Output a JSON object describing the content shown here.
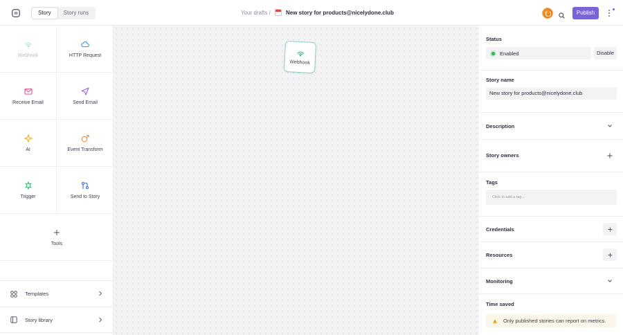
{
  "header": {
    "tabs": [
      {
        "label": "Story",
        "active": true
      },
      {
        "label": "Story runs",
        "active": false
      }
    ],
    "breadcrumb": "Your drafts /",
    "story_title": "New story for products@nicelydone.club",
    "publish_label": "Publish"
  },
  "left_panel": {
    "actions": [
      {
        "label": "Webhook",
        "icon": "webhook-icon",
        "color": "#3cb89a",
        "disabled": true
      },
      {
        "label": "HTTP Request",
        "icon": "cloud-icon",
        "color": "#3a8fe0",
        "disabled": false
      },
      {
        "label": "Receive Email",
        "icon": "mail-icon",
        "color": "#e2508a",
        "disabled": false
      },
      {
        "label": "Send Email",
        "icon": "send-icon",
        "color": "#9a5fe0",
        "disabled": false
      },
      {
        "label": "AI",
        "icon": "sparkle-icon",
        "color": "#e7b626",
        "disabled": false
      },
      {
        "label": "Event Transform",
        "icon": "transform-icon",
        "color": "#f08a3a",
        "disabled": false
      },
      {
        "label": "Trigger",
        "icon": "trigger-icon",
        "color": "#3cc47a",
        "disabled": false
      },
      {
        "label": "Send to Story",
        "icon": "send-to-story-icon",
        "color": "#3a6fe0",
        "disabled": false
      }
    ],
    "tools_label": "Tools",
    "templates_label": "Templates",
    "story_library_label": "Story library"
  },
  "canvas": {
    "node_label": "Webhook",
    "node_color": "#3cb89a"
  },
  "right_panel": {
    "status_title": "Status",
    "status_value": "Enabled",
    "disable_label": "Disable",
    "story_name_title": "Story name",
    "story_name_value": "New story for products@nicelydone.club",
    "description_title": "Description",
    "owners_title": "Story owners",
    "tags_title": "Tags",
    "tags_placeholder": "Click to add a tag...",
    "credentials_title": "Credentials",
    "resources_title": "Resources",
    "monitoring_title": "Monitoring",
    "time_saved_title": "Time saved",
    "time_saved_notice": "Only published stories can report on metrics."
  },
  "colors": {
    "accent": "#7b63d9",
    "status_green": "#3bb05a",
    "warning": "#e0a020"
  }
}
